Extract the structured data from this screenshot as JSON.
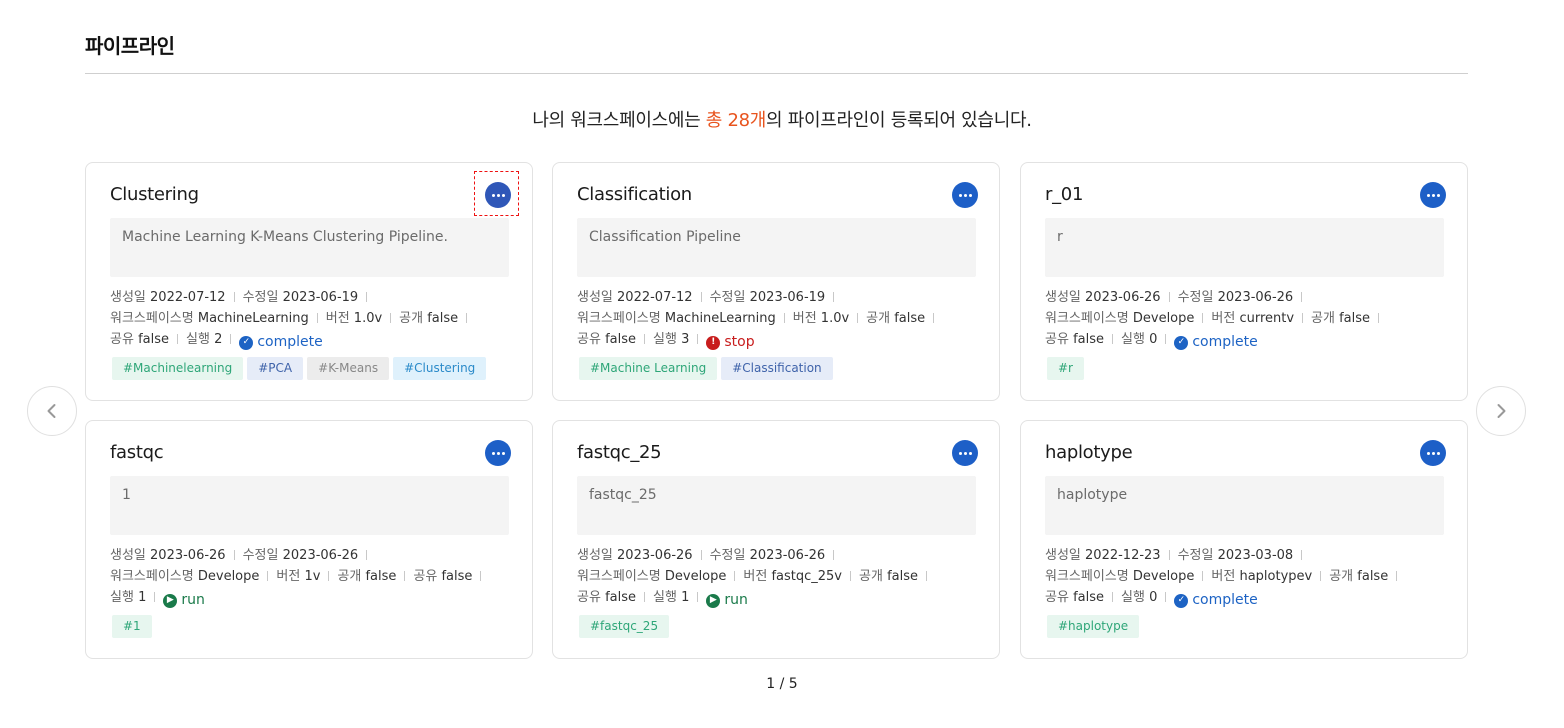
{
  "page": {
    "title": "파이프라인",
    "summary_prefix": "나의 워크스페이스에는 ",
    "summary_highlight": "총 28개",
    "summary_suffix": "의 파이프라인이 등록되어 있습니다."
  },
  "labels": {
    "created": "생성일",
    "modified": "수정일",
    "workspace": "워크스페이스명",
    "version": "버전",
    "public": "공개",
    "shared": "공유",
    "runs": "실행"
  },
  "cards": [
    {
      "title": "Clustering",
      "description": "Machine Learning K-Means Clustering Pipeline.",
      "created": "2022-07-12",
      "modified": "2023-06-19",
      "workspace": "MachineLearning",
      "version": "1.0v",
      "public": "false",
      "shared": "false",
      "runs": "2",
      "status": "complete",
      "tags": [
        "#Machinelearning",
        "#PCA",
        "#K-Means",
        "#Clustering"
      ]
    },
    {
      "title": "Classification",
      "description": "Classification Pipeline",
      "created": "2022-07-12",
      "modified": "2023-06-19",
      "workspace": "MachineLearning",
      "version": "1.0v",
      "public": "false",
      "shared": "false",
      "runs": "3",
      "status": "stop",
      "tags": [
        "#Machine Learning",
        "#Classification"
      ]
    },
    {
      "title": "r_01",
      "description": "r",
      "created": "2023-06-26",
      "modified": "2023-06-26",
      "workspace": "Develope",
      "version": "currentv",
      "public": "false",
      "shared": "false",
      "runs": "0",
      "status": "complete",
      "tags": [
        "#r"
      ]
    },
    {
      "title": "fastqc",
      "description": "1",
      "created": "2023-06-26",
      "modified": "2023-06-26",
      "workspace": "Develope",
      "version": "1v",
      "public": "false",
      "shared": "false",
      "runs": "1",
      "status": "run",
      "tags": [
        "#1"
      ]
    },
    {
      "title": "fastqc_25",
      "description": "fastqc_25",
      "created": "2023-06-26",
      "modified": "2023-06-26",
      "workspace": "Develope",
      "version": "fastqc_25v",
      "public": "false",
      "shared": "false",
      "runs": "1",
      "status": "run",
      "tags": [
        "#fastqc_25"
      ]
    },
    {
      "title": "haplotype",
      "description": "haplotype",
      "created": "2022-12-23",
      "modified": "2023-03-08",
      "workspace": "Develope",
      "version": "haplotypev",
      "public": "false",
      "shared": "false",
      "runs": "0",
      "status": "complete",
      "tags": [
        "#haplotype"
      ]
    }
  ],
  "icons": {
    "more": "more-horizontal-icon",
    "complete": "check-circle-icon",
    "stop": "exclamation-circle-icon",
    "run": "play-circle-icon",
    "prev": "chevron-left-icon",
    "next": "chevron-right-icon"
  },
  "colors": {
    "accent": "#1d5fc7",
    "highlight": "#e8541e",
    "complete": "#1d63c4",
    "stop": "#c81d1d",
    "run": "#1a7a4a"
  },
  "pager": "1 / 5"
}
